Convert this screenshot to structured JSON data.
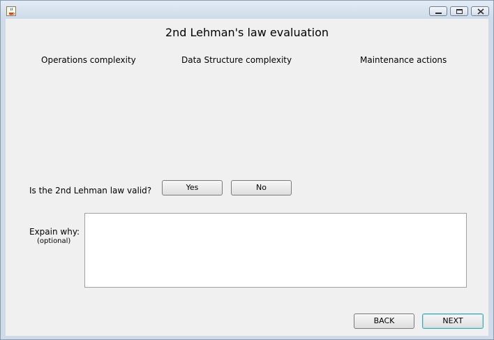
{
  "window": {
    "icon": "java-cup-icon",
    "controls": [
      "minimize-icon",
      "restore-icon",
      "close-icon"
    ]
  },
  "main": {
    "title": "2nd Lehman's law evaluation",
    "columns": [
      {
        "label": "Operations complexity"
      },
      {
        "label": "Data Structure complexity"
      },
      {
        "label": "Maintenance actions"
      }
    ],
    "question": "Is the 2nd Lehman law valid?",
    "yes_label": "Yes",
    "no_label": "No",
    "explain_label": "Expain why:",
    "optional_label": "(optional)",
    "explain_value": "",
    "back_label": "BACK",
    "next_label": "NEXT"
  }
}
